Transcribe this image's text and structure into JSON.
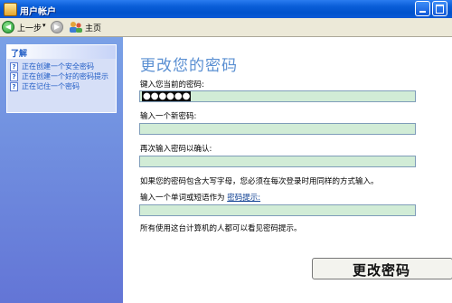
{
  "window": {
    "title": "用户帐户"
  },
  "toolbar": {
    "back_label": "上一步",
    "home_label": "主页"
  },
  "leftpane": {
    "header": "了解",
    "items": [
      {
        "label": "正在创建一个安全密码"
      },
      {
        "label": "正在创建一个好的密码提示"
      },
      {
        "label": "正在记住一个密码"
      }
    ]
  },
  "main": {
    "heading": "更改您的密码",
    "current_password": {
      "label": "键入您当前的密码:",
      "value": "●●●●●●"
    },
    "new_password": {
      "label": "输入一个新密码:",
      "value": ""
    },
    "confirm_password": {
      "label": "再次输入密码以确认:",
      "value": ""
    },
    "case_note": "如果您的密码包含大写字母，您必须在每次登录时用同样的方式输入。",
    "hint_prompt": "输入一个单词或短语作为",
    "hint_link": "密码提示:",
    "hint_value": "",
    "hint_note": "所有使用这台计算机的人都可以看见密码提示。",
    "change_button": "更改密码"
  },
  "colors": {
    "titlebar": "#0a5ed8",
    "taskpane": "#6f8fe0",
    "input_bg": "#d1ecd6",
    "heading": "#5a8fd2"
  }
}
